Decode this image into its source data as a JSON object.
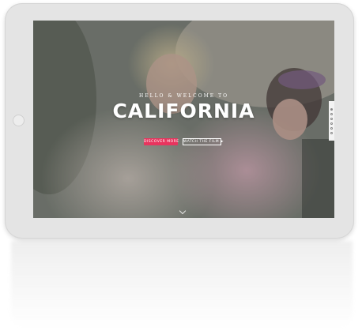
{
  "hero": {
    "subtitle": "HELLO & WELCOME TO",
    "title": "CALIFORNIA"
  },
  "buttons": {
    "primary_label": "DISCOVER MORE",
    "secondary_label": "WATCH THE FILM ▶"
  },
  "side_nav": {
    "dots": 6,
    "active_index": 0
  },
  "colors": {
    "accent": "#e8345e",
    "device": "#e4e4e4"
  }
}
